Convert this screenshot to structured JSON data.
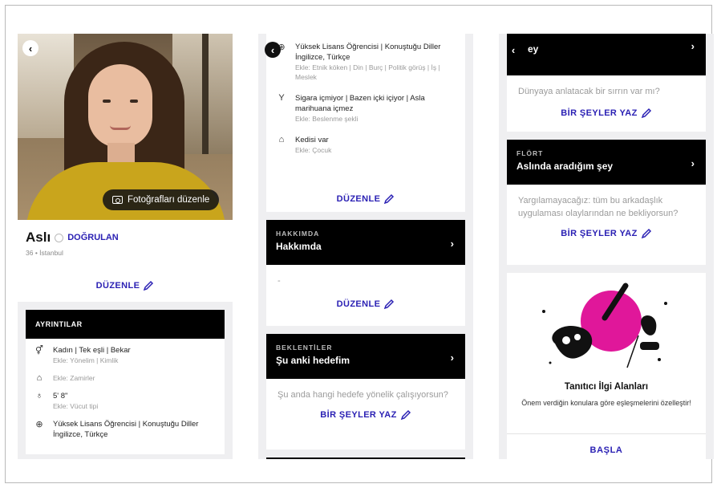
{
  "colors": {
    "accent": "#2b21b4",
    "header_black": "#000000",
    "panel_bg": "#efeff1",
    "magenta": "#e0179a"
  },
  "panel1": {
    "edit_photos_label": "Fotoğrafları düzenle",
    "name": "Aslı",
    "verified_label": "DOĞRULAN",
    "subtitle": "36 • İstanbul",
    "edit_label": "DÜZENLE",
    "details_header": "AYRINTILAR",
    "details": [
      {
        "icon": "gender-icon",
        "main": "Kadın | Tek eşli | Bekar",
        "sub": "Ekle: Yönelim | Kimlik"
      },
      {
        "icon": "tag-icon",
        "main": "",
        "sub": "Ekle: Zamirler"
      },
      {
        "icon": "height-icon",
        "main": "5' 8\"",
        "sub": "Ekle: Vücut tipi"
      },
      {
        "icon": "globe-icon",
        "main": "Yüksek Lisans Öğrencisi | Konuştuğu Diller İngilizce, Türkçe",
        "sub": ""
      }
    ]
  },
  "panel2": {
    "items": [
      {
        "icon": "globe-icon",
        "main": "Yüksek Lisans Öğrencisi | Konuştuğu Diller İngilizce, Türkçe",
        "sub": "Ekle: Etnik köken | Din | Burç | Politik görüş | İş | Meslek"
      },
      {
        "icon": "drink-icon",
        "main": "Sigara içmiyor | Bazen içki içiyor | Asla marihuana içmez",
        "sub": "Ekle: Beslenme şekli"
      },
      {
        "icon": "pet-icon",
        "main": "Kedisi var",
        "sub": "Ekle: Çocuk"
      }
    ],
    "edit_label": "DÜZENLE",
    "about_label": "HAKKIMDA",
    "about_title": "Hakkımda",
    "about_body": "-",
    "about_edit": "DÜZENLE",
    "expect_label": "BEKLENTİLER",
    "expect_title": "Şu anki hedefim",
    "expect_question": "Şu anda hangi hedefe yönelik çalışıyorsun?",
    "write_label": "BİR ŞEYLER YAZ"
  },
  "panel3": {
    "top_title": "ey",
    "secret_question": "Dünyaya anlatacak bir sırrın var mı?",
    "write_label": "BİR ŞEYLER YAZ",
    "flirt_label": "FLÖRT",
    "flirt_title": "Aslında aradığım şey",
    "flirt_question": "Yargılamayacağız: tüm bu arkadaşlık uygulaması olaylarından ne bekliyorsun?",
    "write_label2": "BİR ŞEYLER YAZ",
    "illu_title": "Tanıtıcı İlgi Alanları",
    "illu_desc": "Önem verdiğin konulara göre eşleşmelerini özelleştir!",
    "start_label": "BAŞLA"
  }
}
